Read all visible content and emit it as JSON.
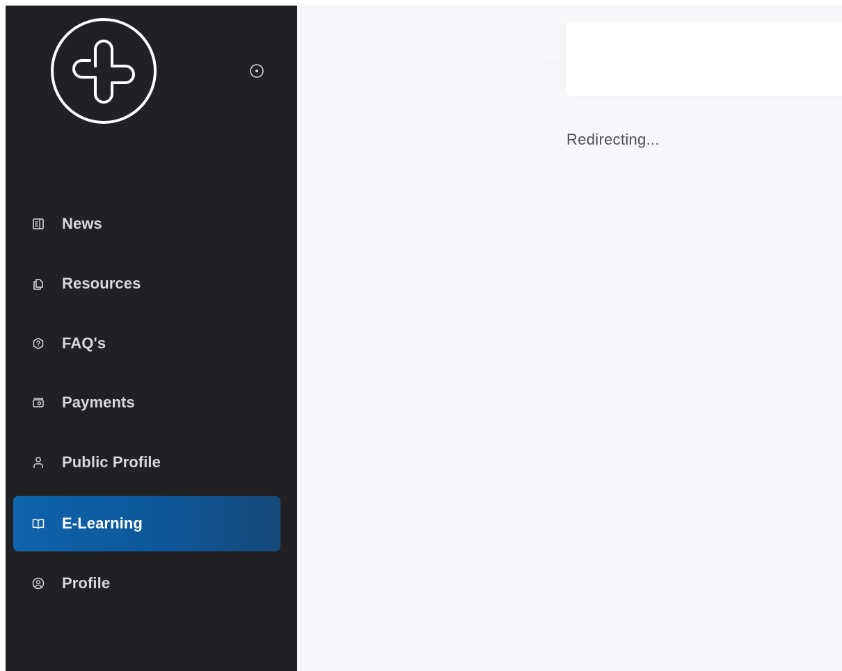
{
  "sidebar": {
    "logo_icon": "rounded-cross-logo-icon",
    "collapse_icon": "circle-dot-icon",
    "items": [
      {
        "label": "News",
        "icon": "newspaper-icon",
        "active": false
      },
      {
        "label": "Resources",
        "icon": "documents-icon",
        "active": false
      },
      {
        "label": "FAQ's",
        "icon": "question-hexagon-icon",
        "active": false
      },
      {
        "label": "Payments",
        "icon": "wallet-icon",
        "active": false
      },
      {
        "label": "Public Profile",
        "icon": "user-icon",
        "active": false
      },
      {
        "label": "E-Learning",
        "icon": "open-book-icon",
        "active": true
      },
      {
        "label": "Profile",
        "icon": "user-circle-icon",
        "active": false
      }
    ]
  },
  "main": {
    "status_text": "Redirecting..."
  },
  "colors": {
    "sidebar_bg": "#212125",
    "main_bg": "#f7f7f9",
    "active_accent": "#0f64ad",
    "nav_text": "#d6d8dc",
    "status_text": "#4a4d55"
  }
}
